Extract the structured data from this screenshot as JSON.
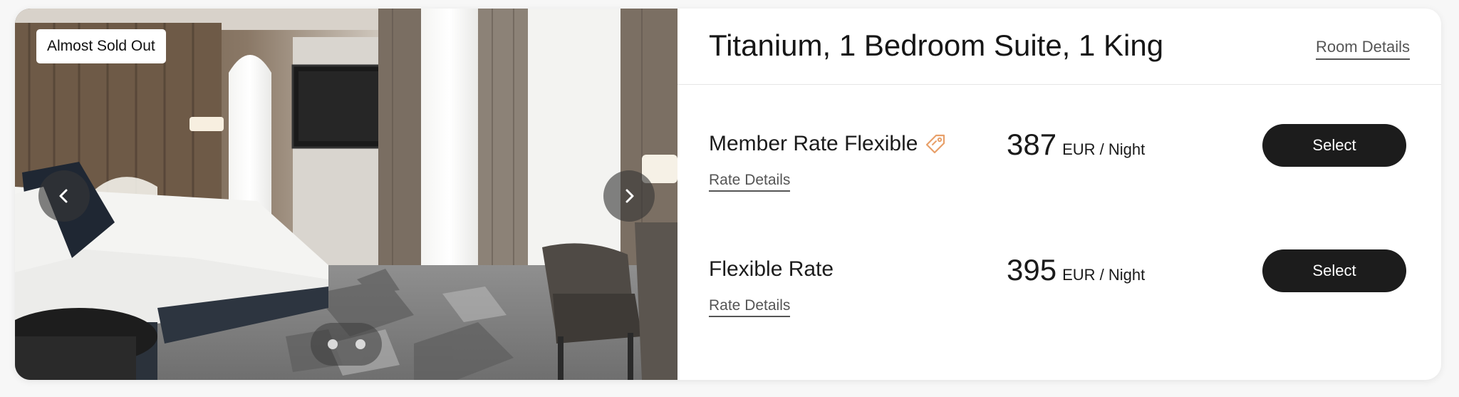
{
  "gallery": {
    "badge": "Almost Sold Out",
    "prev_icon": "chevron-left-icon",
    "next_icon": "chevron-right-icon",
    "slide_count": 2,
    "active_slide": 1
  },
  "room": {
    "title": "Titanium, 1 Bedroom Suite, 1 King",
    "details_link": "Room Details"
  },
  "rates": [
    {
      "name": "Member Rate Flexible",
      "has_member_tag": true,
      "tag_icon": "tag-icon",
      "tag_color": "#e8a06a",
      "details_link": "Rate Details",
      "price": "387",
      "unit": "EUR / Night",
      "select_label": "Select"
    },
    {
      "name": "Flexible Rate",
      "has_member_tag": false,
      "details_link": "Rate Details",
      "price": "395",
      "unit": "EUR / Night",
      "select_label": "Select"
    }
  ],
  "colors": {
    "button": "#1c1c1c",
    "accent_tag": "#e8a06a"
  }
}
